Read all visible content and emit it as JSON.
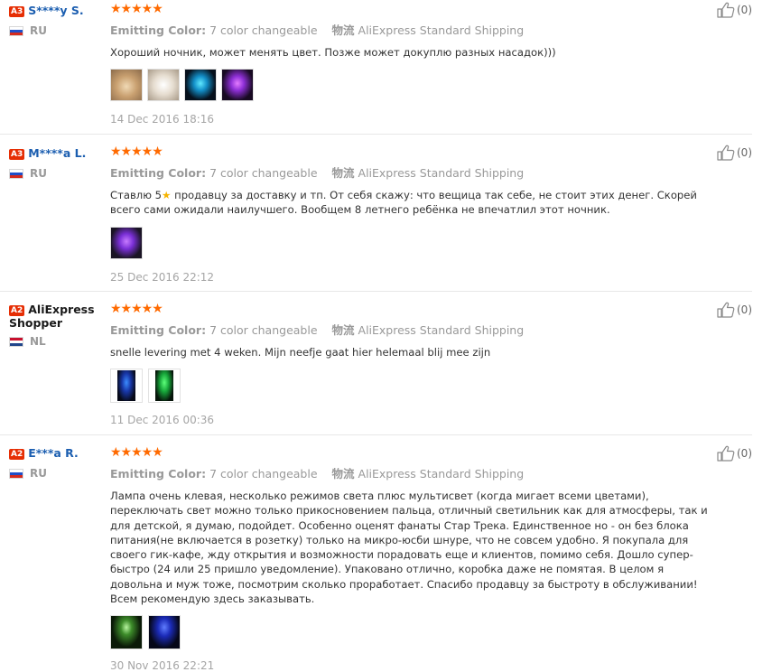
{
  "reviews": [
    {
      "level": "A3",
      "user": "S****y S.",
      "country": "RU",
      "flag": "ru",
      "stars": 5,
      "stars_text": "★★★★★",
      "attr_label": "Emitting Color:",
      "attr_value": "7 color changeable",
      "logistics_label": "物流",
      "logistics_value": "AliExpress Standard Shipping",
      "text": "Хороший ночник, может менять цвет. Позже может докуплю разных насадок)))",
      "photo_icons": [
        "lamp-photo-beige",
        "lamp-photo-white",
        "lamp-photo-blue",
        "lamp-photo-purple"
      ],
      "date": "14 Dec 2016 18:16",
      "useful": "(0)"
    },
    {
      "level": "A3",
      "user": "M****a L.",
      "country": "RU",
      "flag": "ru",
      "stars": 5,
      "stars_text": "★★★★★",
      "attr_label": "Emitting Color:",
      "attr_value": "7 color changeable",
      "logistics_label": "物流",
      "logistics_value": "AliExpress Standard Shipping",
      "text_pre": "Ставлю 5",
      "text_star": "★",
      "text": " продавцу за доставку и тп. От себя скажу: что вещица так себе, не стоит этих денег. Скорей всего сами ожидали наилучшего. Вообщем 8 летнего ребёнка не впечатлил этот ночник.",
      "photo_icons": [
        "lamp-photo-purple"
      ],
      "date": "25 Dec 2016 22:12",
      "useful": "(0)"
    },
    {
      "level": "A2",
      "user": "AliExpress Shopper",
      "country": "NL",
      "flag": "nl",
      "stars": 5,
      "stars_text": "★★★★★",
      "attr_label": "Emitting Color:",
      "attr_value": "7 color changeable",
      "logistics_label": "物流",
      "logistics_value": "AliExpress Standard Shipping",
      "text": "snelle levering met 4 weken. Mijn neefje gaat hier helemaal blij mee zijn",
      "photo_icons": [
        "lamp-photo-dark-blue",
        "lamp-photo-dark-green"
      ],
      "date": "11 Dec 2016 00:36",
      "useful": "(0)"
    },
    {
      "level": "A2",
      "user": "E***a R.",
      "country": "RU",
      "flag": "ru",
      "stars": 5,
      "stars_text": "★★★★★",
      "attr_label": "Emitting Color:",
      "attr_value": "7 color changeable",
      "logistics_label": "物流",
      "logistics_value": "AliExpress Standard Shipping",
      "text": "Лампа очень клевая, несколько режимов света плюс мультисвет (когда мигает всеми цветами), переключать свет можно только прикосновением пальца, отличный светильник как для атмосферы, так и для детской, я думаю, подойдет. Особенно оценят фанаты Стар Трека. Единственное но - он без блока питания(не включается в розетку) только на микро-юсби шнуре, что не совсем удобно. Я покупала для своего гик-кафе, жду открытия и возможности порадовать еще и клиентов, помимо себя. Дошло супер-быстро (24 или 25 пришло уведомление). Упаковано отлично, коробка даже не помятая. В целом я довольна и муж тоже, посмотрим сколько проработает. Спасибо продавцу за быстроту в обслуживании! Всем рекомендую здесь заказывать.",
      "photo_icons": [
        "lamp-photo-dark-green",
        "lamp-photo-dark-blue"
      ],
      "date": "30 Nov 2016 22:21",
      "useful": "(0)"
    }
  ],
  "colors": {
    "badge": "#e62e04",
    "username": "#1b5eb0",
    "stars": "#ff6a00",
    "meta": "#999999"
  }
}
